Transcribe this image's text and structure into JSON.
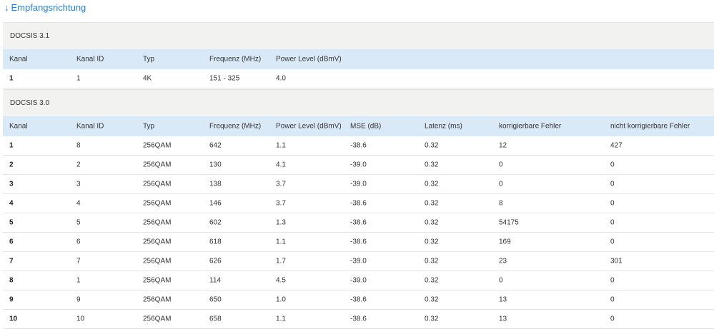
{
  "heading": {
    "arrow": "↓",
    "title": "Empfangsrichtung"
  },
  "docsis31": {
    "title": "DOCSIS 3.1",
    "headers": [
      "Kanal",
      "Kanal ID",
      "Typ",
      "Frequenz (MHz)",
      "Power Level (dBmV)"
    ],
    "rows": [
      [
        "1",
        "1",
        "4K",
        "151 - 325",
        "4.0"
      ]
    ]
  },
  "docsis30": {
    "title": "DOCSIS 3.0",
    "headers": [
      "Kanal",
      "Kanal ID",
      "Typ",
      "Frequenz (MHz)",
      "Power Level (dBmV)",
      "MSE (dB)",
      "Latenz (ms)",
      "korrigierbare Fehler",
      "nicht korrigierbare Fehler"
    ],
    "rows": [
      [
        "1",
        "8",
        "256QAM",
        "642",
        "1.1",
        "-38.6",
        "0.32",
        "12",
        "427"
      ],
      [
        "2",
        "2",
        "256QAM",
        "130",
        "4.1",
        "-39.0",
        "0.32",
        "0",
        "0"
      ],
      [
        "3",
        "3",
        "256QAM",
        "138",
        "3.7",
        "-39.0",
        "0.32",
        "0",
        "0"
      ],
      [
        "4",
        "4",
        "256QAM",
        "146",
        "3.7",
        "-38.6",
        "0.32",
        "8",
        "0"
      ],
      [
        "5",
        "5",
        "256QAM",
        "602",
        "1.3",
        "-38.6",
        "0.32",
        "54175",
        "0"
      ],
      [
        "6",
        "6",
        "256QAM",
        "618",
        "1.1",
        "-38.6",
        "0.32",
        "169",
        "0"
      ],
      [
        "7",
        "7",
        "256QAM",
        "626",
        "1.7",
        "-39.0",
        "0.32",
        "23",
        "301"
      ],
      [
        "8",
        "1",
        "256QAM",
        "114",
        "4.5",
        "-39.0",
        "0.32",
        "0",
        "0"
      ],
      [
        "9",
        "9",
        "256QAM",
        "650",
        "1.0",
        "-38.6",
        "0.32",
        "13",
        "0"
      ],
      [
        "10",
        "10",
        "256QAM",
        "658",
        "1.1",
        "-38.6",
        "0.32",
        "13",
        "0"
      ]
    ]
  }
}
